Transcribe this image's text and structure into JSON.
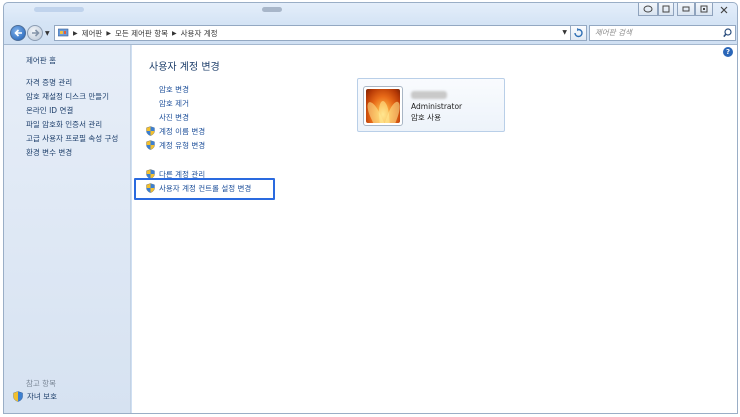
{
  "address_bar": {
    "crumbs": [
      "제어판",
      "모든 제어판 항목",
      "사용자 계정"
    ],
    "search_placeholder": "제어판 검색"
  },
  "sidebar": {
    "home": "제어판 홈",
    "links": [
      "자격 증명 관리",
      "암호 재설정 디스크 만들기",
      "온라인 ID 연결",
      "파일 암호화 인증서 관리",
      "고급 사용자 프로필 속성 구성",
      "환경 변수 변경"
    ],
    "see_also": "참고 항목",
    "parental": "자녀 보호"
  },
  "main": {
    "help_label": "?",
    "title": "사용자 계정 변경",
    "tasks": [
      {
        "label": "암호 변경",
        "shield": false
      },
      {
        "label": "암호 제거",
        "shield": false
      },
      {
        "label": "사진 변경",
        "shield": false
      },
      {
        "label": "계정 이름 변경",
        "shield": true
      },
      {
        "label": "계정 유형 변경",
        "shield": true
      }
    ],
    "tasks2": [
      {
        "label": "다른 계정 관리",
        "shield": true
      },
      {
        "label": "사용자 계정 컨트롤 설정 변경",
        "shield": true
      }
    ],
    "user": {
      "role": "Administrator",
      "status": "암호 사용"
    }
  },
  "colors": {
    "highlight_border": "#2a6adf",
    "link": "#1d4f9a",
    "title": "#1e3f6b"
  }
}
